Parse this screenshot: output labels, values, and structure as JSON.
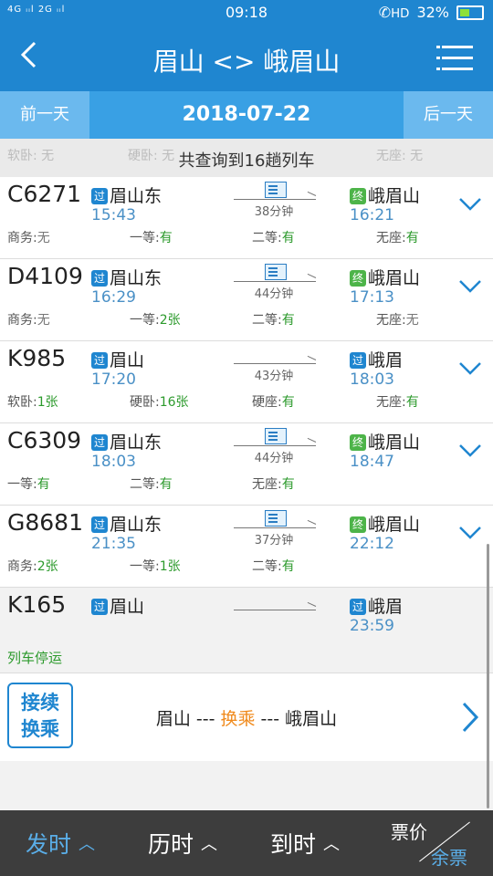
{
  "status": {
    "signal": "4G ᵢᵢl 2G ᵢᵢl",
    "time": "09:18",
    "hd": "HD",
    "battery": "32%"
  },
  "header": {
    "title": "眉山 <> 峨眉山"
  },
  "datebar": {
    "prev": "前一天",
    "date": "2018-07-22",
    "next": "后一天"
  },
  "peek": {
    "p1": "软卧: 无",
    "p2": "硬卧: 无",
    "p3": "无座: 无",
    "message": "共查询到16趟列车"
  },
  "trains": [
    {
      "code": "C6271",
      "from_badge": "过",
      "from": "眉山东",
      "dep": "15:43",
      "duration": "38分钟",
      "to_badge": "终",
      "to": "峨眉山",
      "arr": "16:21",
      "seats": [
        {
          "label": "商务:",
          "value": "无"
        },
        {
          "label": "一等:",
          "value": "有"
        },
        {
          "label": "二等:",
          "value": "有"
        },
        {
          "label": "无座:",
          "value": "有"
        }
      ]
    },
    {
      "code": "D4109",
      "from_badge": "过",
      "from": "眉山东",
      "dep": "16:29",
      "duration": "44分钟",
      "to_badge": "终",
      "to": "峨眉山",
      "arr": "17:13",
      "seats": [
        {
          "label": "商务:",
          "value": "无"
        },
        {
          "label": "一等:",
          "value": "2张"
        },
        {
          "label": "二等:",
          "value": "有"
        },
        {
          "label": "无座:",
          "value": "无"
        }
      ]
    },
    {
      "code": "K985",
      "from_badge": "过",
      "from": "眉山",
      "dep": "17:20",
      "duration": "43分钟",
      "to_badge": "过",
      "to": "峨眉",
      "arr": "18:03",
      "seats": [
        {
          "label": "软卧:",
          "value": "1张"
        },
        {
          "label": "硬卧:",
          "value": "16张"
        },
        {
          "label": "硬座:",
          "value": "有"
        },
        {
          "label": "无座:",
          "value": "有"
        }
      ]
    },
    {
      "code": "C6309",
      "from_badge": "过",
      "from": "眉山东",
      "dep": "18:03",
      "duration": "44分钟",
      "to_badge": "终",
      "to": "峨眉山",
      "arr": "18:47",
      "seats": [
        {
          "label": "一等:",
          "value": "有"
        },
        {
          "label": "二等:",
          "value": "有"
        },
        {
          "label": "无座:",
          "value": "有"
        }
      ]
    },
    {
      "code": "G8681",
      "from_badge": "过",
      "from": "眉山东",
      "dep": "21:35",
      "duration": "37分钟",
      "to_badge": "终",
      "to": "峨眉山",
      "arr": "22:12",
      "seats": [
        {
          "label": "商务:",
          "value": "2张"
        },
        {
          "label": "一等:",
          "value": "1张"
        },
        {
          "label": "二等:",
          "value": "有"
        }
      ]
    },
    {
      "code": "K165",
      "from_badge": "过",
      "from": "眉山",
      "dep": "",
      "duration": "",
      "to_badge": "过",
      "to": "峨眉",
      "arr": "23:59",
      "stopped": "列车停运"
    }
  ],
  "transfer": {
    "label": "接续换乘",
    "from": "眉山 --- ",
    "mid": "换乘",
    "to": " --- 峨眉山"
  },
  "bottom": {
    "sort1": "发时",
    "sort2": "历时",
    "sort3": "到时",
    "price_top": "票价",
    "price_bottom": "余票"
  },
  "colors": {
    "primary": "#1f86d0",
    "available": "#2c9a2c",
    "time": "#4a90c6",
    "transfer_highlight": "#f08a1c"
  }
}
